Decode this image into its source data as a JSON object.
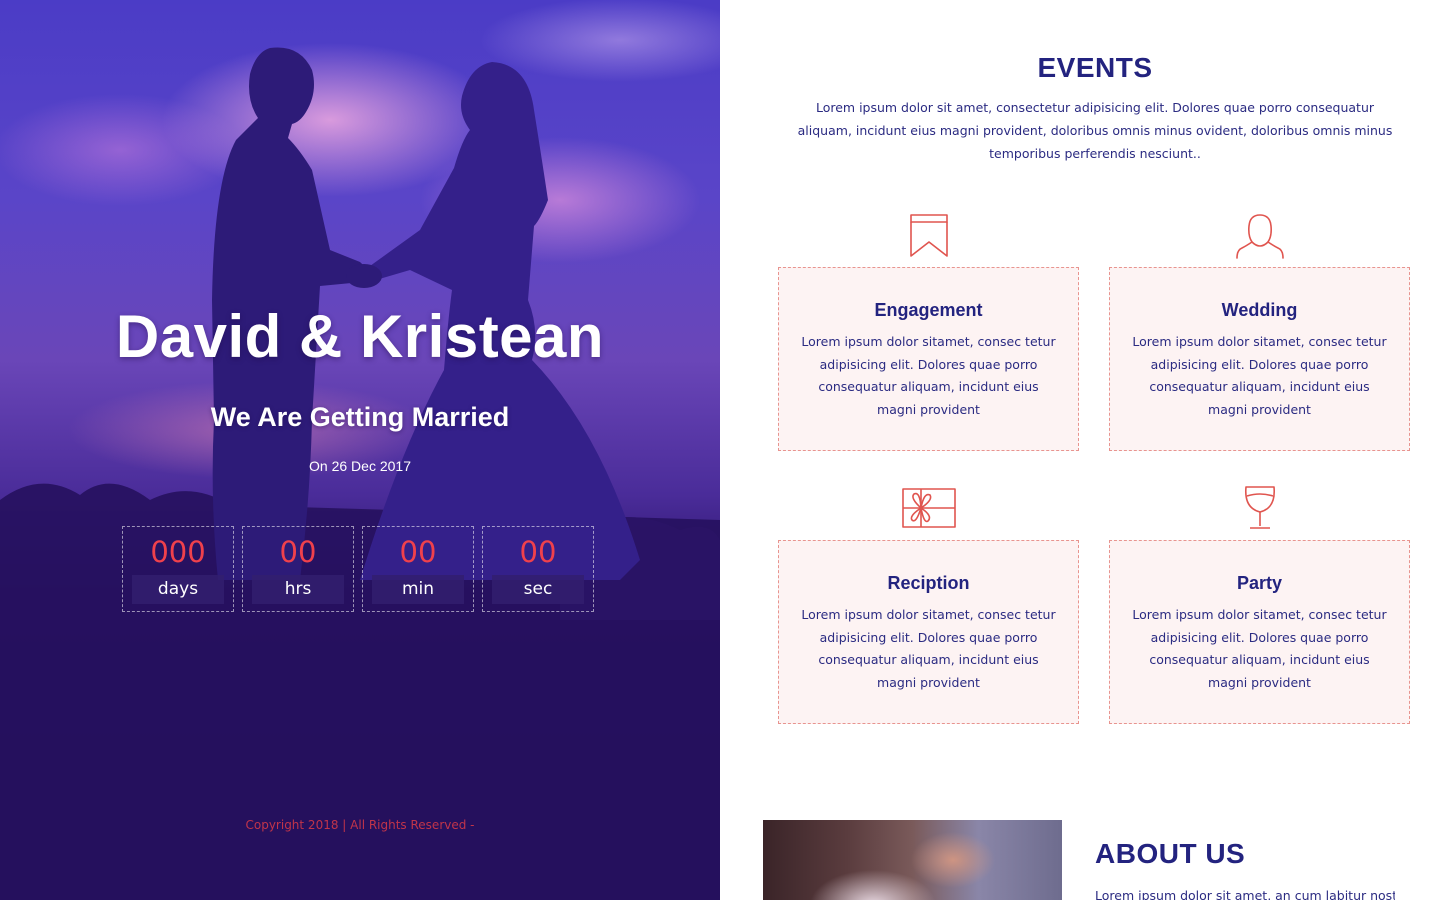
{
  "hero": {
    "title": "David & Kristean",
    "subtitle": "We Are Getting Married",
    "date": "On 26 Dec 2017",
    "countdown": [
      {
        "value": "000",
        "unit": "days"
      },
      {
        "value": "00",
        "unit": "hrs"
      },
      {
        "value": "00",
        "unit": "min"
      },
      {
        "value": "00",
        "unit": "sec"
      }
    ],
    "copyright": "Copyright 2018 | All Rights Reserved -"
  },
  "events": {
    "title": "EVENTS",
    "intro": "Lorem ipsum dolor sit amet, consectetur adipisicing elit. Dolores quae porro consequatur aliquam, incidunt eius magni provident, doloribus omnis minus ovident, doloribus omnis minus temporibus perferendis nesciunt..",
    "items": [
      {
        "icon": "bookmark-icon",
        "title": "Engagement",
        "text": "Lorem ipsum dolor sitamet, consec tetur adipisicing elit. Dolores quae porro consequatur aliquam, incidunt eius magni provident"
      },
      {
        "icon": "bride-icon",
        "title": "Wedding",
        "text": "Lorem ipsum dolor sitamet, consec tetur adipisicing elit. Dolores quae porro consequatur aliquam, incidunt eius magni provident"
      },
      {
        "icon": "gift-icon",
        "title": "Reciption",
        "text": "Lorem ipsum dolor sitamet, consec tetur adipisicing elit. Dolores quae porro consequatur aliquam, incidunt eius magni provident"
      },
      {
        "icon": "wine-glass-icon",
        "title": "Party",
        "text": "Lorem ipsum dolor sitamet, consec tetur adipisicing elit. Dolores quae porro consequatur aliquam, incidunt eius magni provident"
      }
    ]
  },
  "about": {
    "title": "ABOUT US",
    "text": "Lorem ipsum dolor sit amet, an cum labitur noster"
  },
  "colors": {
    "primary": "#23237f",
    "accent": "#f0414c",
    "card_bg": "#fdf3f3",
    "card_border": "#e8948f"
  }
}
